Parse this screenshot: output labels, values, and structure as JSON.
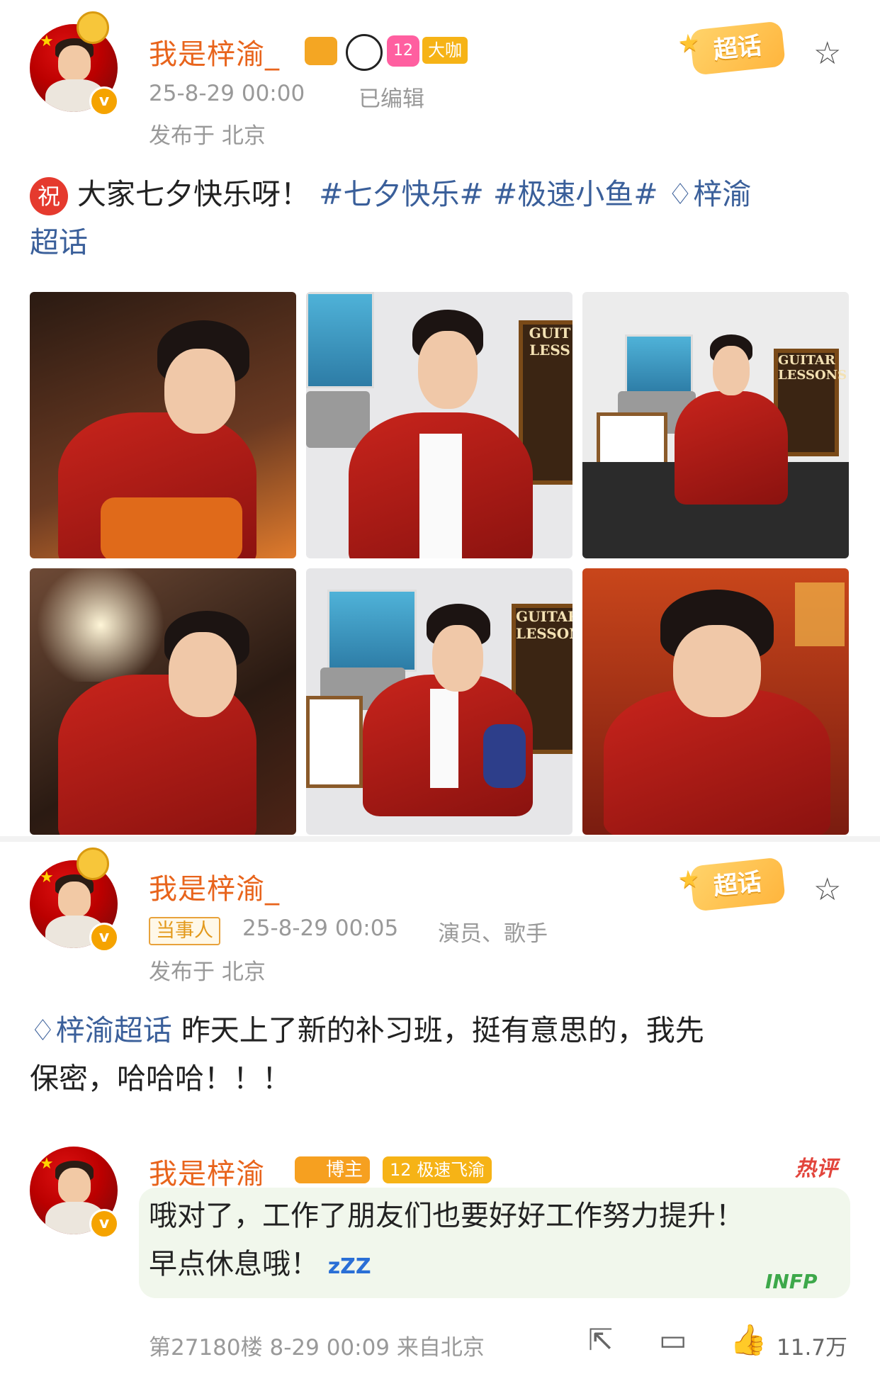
{
  "post": {
    "author": "我是梓渝_",
    "badge_vip": "大咖",
    "badge_level": "12",
    "time": "25-8-29 00:00",
    "edited": "已编辑",
    "location": "发布于 北京",
    "supertalk_label": "超话",
    "blessing_icon": "祝",
    "text_plain": "大家七夕快乐呀！",
    "hashtag1": "#七夕快乐#",
    "hashtag2": "#极速小鱼#",
    "supertalk_link_line1": "梓渝",
    "supertalk_link_line2": "超话"
  },
  "repost": {
    "author": "我是梓渝_",
    "tag": "当事人",
    "time": "25-8-29 00:05",
    "role": "演员、歌手",
    "location": "发布于 北京",
    "supertalk_label": "超话",
    "supertalk_link": "梓渝超话",
    "text_line1": "昨天上了新的补习班，挺有意思的，我先",
    "text_line2": "保密，哈哈哈！！！"
  },
  "comment": {
    "author": "我是梓渝_",
    "badge_blogger": "博主",
    "badge_fan_level": "12",
    "badge_fan_name": "极速飞渝",
    "hot_label": "热评",
    "text_line1": "哦对了，工作了朋友们也要好好工作努力提升！",
    "text_line2": "早点休息哦！",
    "zzz": "zZZ",
    "sticker": "INFP",
    "floor": "第27180楼",
    "time": "8-29 00:09",
    "source": "来自北京",
    "likes": "11.7万"
  },
  "colors": {
    "nick": "#e8641c",
    "link": "#3a5f9a",
    "meta": "#999999",
    "supertalk": "#ffb53d",
    "hot": "#e2453c"
  },
  "icons": [
    "star-icon",
    "verified-icon",
    "share-icon",
    "comment-icon",
    "like-icon",
    "diamond-icon"
  ]
}
